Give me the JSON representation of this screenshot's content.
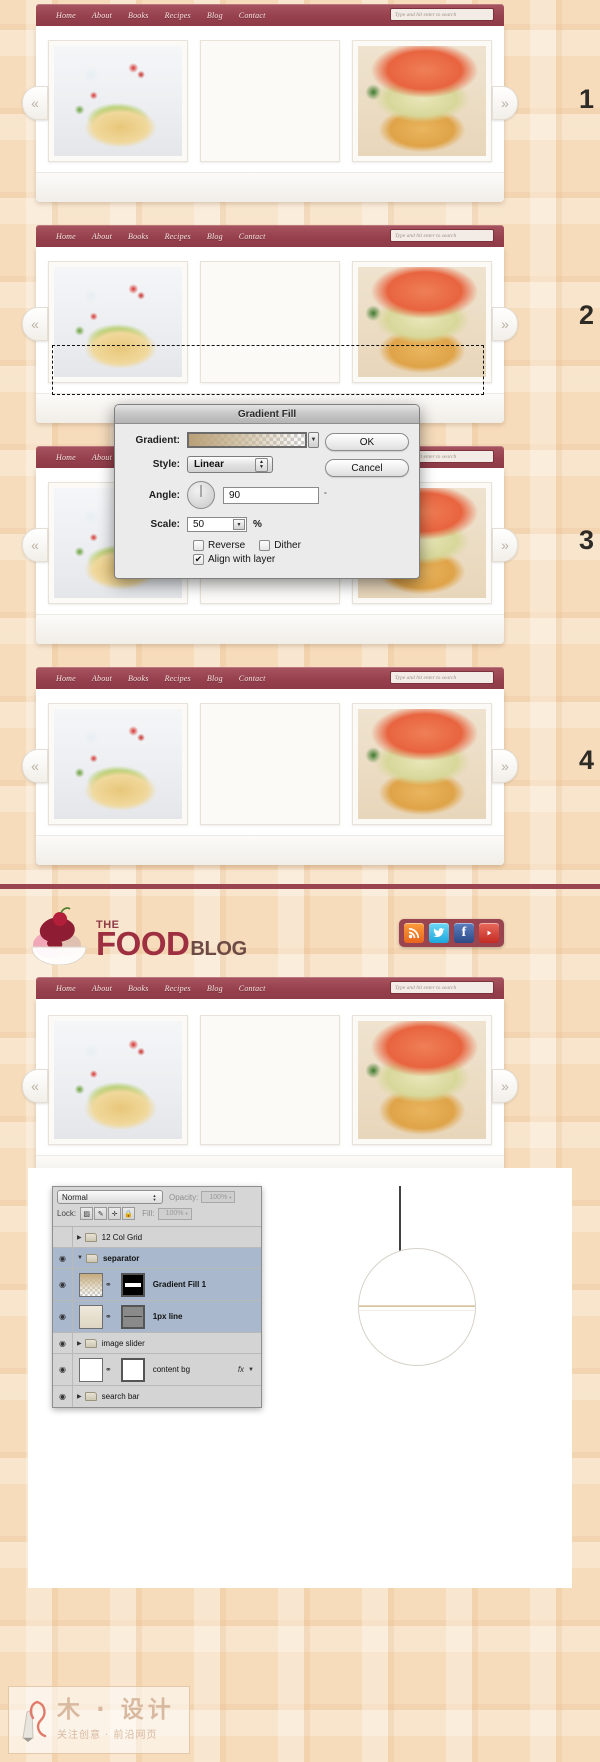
{
  "nav": {
    "items": [
      "Home",
      "About",
      "Books",
      "Recipes",
      "Blog",
      "Contact"
    ],
    "search_placeholder": "Type and hit enter to search"
  },
  "slider": {
    "prev_icon": "«",
    "next_icon": "»",
    "images": [
      "chicken-salad-flatbread-photo",
      "greek-salad-bowl-photo",
      "loaded-flatbread-closeup-photo"
    ]
  },
  "steps": [
    "1",
    "2",
    "3",
    "4"
  ],
  "dialog": {
    "title": "Gradient Fill",
    "gradient_label": "Gradient:",
    "style_label": "Style:",
    "style_value": "Linear",
    "angle_label": "Angle:",
    "angle_value": "90",
    "degree_symbol": "°",
    "scale_label": "Scale:",
    "scale_value": "50",
    "percent_symbol": "%",
    "reverse_label": "Reverse",
    "reverse_checked": "",
    "dither_label": "Dither",
    "dither_checked": "",
    "align_label": "Align with layer",
    "align_checked": "✔",
    "ok_label": "OK",
    "cancel_label": "Cancel",
    "dropdown_icon": "▼",
    "stepper_up": "▲",
    "stepper_down": "▼"
  },
  "brand": {
    "the": "THE",
    "food": "FOOD",
    "blog": "BLOG"
  },
  "social": [
    {
      "name": "rss-icon",
      "glyph": "◔",
      "color": "#f07c24"
    },
    {
      "name": "twitter-icon",
      "glyph": "✉",
      "color": "#2cb7e8"
    },
    {
      "name": "facebook-icon",
      "glyph": "f",
      "color": "#3b5a9b"
    },
    {
      "name": "youtube-icon",
      "glyph": "▶",
      "color": "#d43b32"
    }
  ],
  "layers_panel": {
    "blend_mode": "Normal",
    "opacity_label": "Opacity:",
    "opacity_value": "100%",
    "lock_label": "Lock:",
    "lock_icons": [
      "transparency-lock-icon",
      "brush-lock-icon",
      "move-lock-icon",
      "all-lock-icon"
    ],
    "fill_label": "Fill:",
    "fill_value": "100%",
    "rows": [
      {
        "name": "12 Col Grid",
        "type": "group",
        "eye": "",
        "selected": false,
        "bold": false
      },
      {
        "name": "separator",
        "type": "group",
        "eye": "◉",
        "selected": true,
        "bold": true
      },
      {
        "name": "Gradient Fill 1",
        "type": "layer",
        "eye": "◉",
        "selected": true,
        "bold": true
      },
      {
        "name": "1px line",
        "type": "layer",
        "eye": "◉",
        "selected": true,
        "bold": true
      },
      {
        "name": "image slider",
        "type": "group",
        "eye": "◉",
        "selected": false,
        "bold": false
      },
      {
        "name": "content bg",
        "type": "layer",
        "eye": "◉",
        "selected": false,
        "bold": false,
        "fx": "fx"
      },
      {
        "name": "search bar",
        "type": "group",
        "eye": "◉",
        "selected": false,
        "bold": false
      }
    ],
    "expand_collapsed": "▶",
    "expand_open": "▼",
    "link_icon": "⚭"
  },
  "watermark": {
    "main": "木 · 设计",
    "sub": "关注创意 · 前沿网页"
  },
  "colors": {
    "nav_bar": "#97414e",
    "brand_red": "#9e2f41",
    "brand_brown": "#6d4a45",
    "page_bg": "#f6dcbb",
    "selection_blue": "#a9b8cc"
  }
}
